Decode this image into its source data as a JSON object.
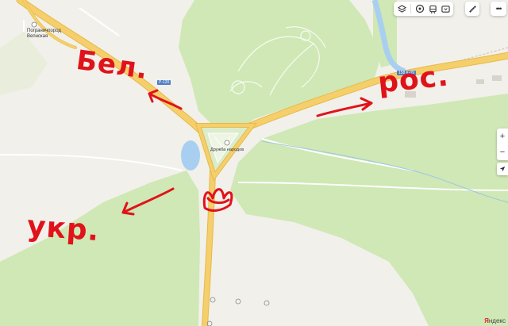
{
  "map": {
    "places": {
      "border_post": "Пограничпород Вепнская",
      "monument": "Дружба народов"
    },
    "road_shields": {
      "west": "Р-120",
      "east": "158 К-09"
    }
  },
  "annotations": {
    "belarus": "Бел.",
    "russia": "рос.",
    "ukraine": "укр."
  },
  "toolbar": {
    "icons": [
      "layers-icon",
      "panorama-icon",
      "transport-icon",
      "traffic-icon",
      "ruler-icon",
      "more-icon"
    ]
  },
  "controls": {
    "zoom_in": "+",
    "zoom_out": "−"
  },
  "attribution": {
    "brand_prefix": "Я",
    "brand_rest": "ндекс"
  },
  "colors": {
    "land": "#f2f0ea",
    "forest": "#cfe8b5",
    "road_major": "#f5cf6b",
    "water": "#a9cff0",
    "marker_red": "#e0131a"
  }
}
